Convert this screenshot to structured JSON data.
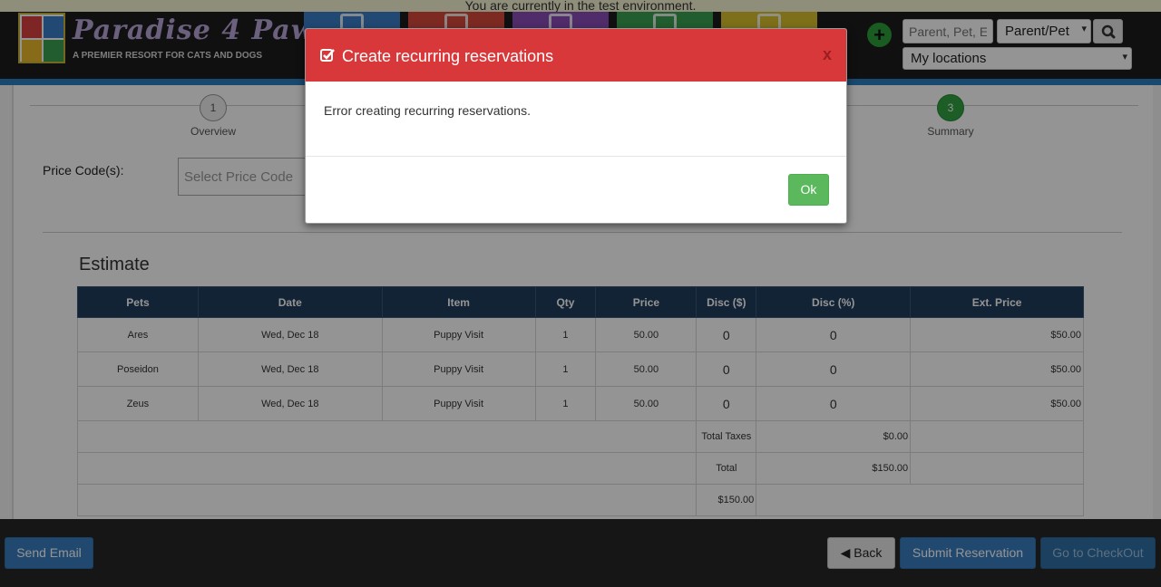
{
  "header": {
    "env_notice": "You are currently in the test environment.",
    "logo": {
      "name": "Paradise 4 Paws",
      "tagline": "A PREMIER RESORT FOR CATS AND DOGS"
    },
    "nav_tile_colors": [
      "#3a7fc8",
      "#d8493c",
      "#8a4db8",
      "#3aa050",
      "#d9c22e"
    ],
    "add_icon": "plus-circle-icon",
    "search": {
      "placeholder": "Parent, Pet, E",
      "value": ""
    },
    "search_type": {
      "selected": "Parent/Pet"
    },
    "search_icon": "search-icon",
    "location": {
      "selected": "My locations"
    }
  },
  "wizard": {
    "steps": [
      {
        "number": "1",
        "label": "Overview",
        "state": "inactive"
      },
      {
        "number": "3",
        "label": "Summary",
        "state": "active"
      }
    ]
  },
  "form": {
    "price_code_label": "Price Code(s):",
    "price_code_placeholder": "Select Price Code"
  },
  "estimate": {
    "title": "Estimate",
    "columns": [
      "Pets",
      "Date",
      "Item",
      "Qty",
      "Price",
      "Disc ($)",
      "Disc (%)",
      "Ext. Price"
    ],
    "rows": [
      {
        "pet": "Ares",
        "date": "Wed, Dec 18",
        "item": "Puppy Visit",
        "qty": "1",
        "price": "50.00",
        "disc_d": "0",
        "disc_p": "0",
        "ext": "$50.00"
      },
      {
        "pet": "Poseidon",
        "date": "Wed, Dec 18",
        "item": "Puppy Visit",
        "qty": "1",
        "price": "50.00",
        "disc_d": "0",
        "disc_p": "0",
        "ext": "$50.00"
      },
      {
        "pet": "Zeus",
        "date": "Wed, Dec 18",
        "item": "Puppy Visit",
        "qty": "1",
        "price": "50.00",
        "disc_d": "0",
        "disc_p": "0",
        "ext": "$50.00"
      }
    ],
    "total_taxes_label": "Total Taxes",
    "total_taxes_value": "$0.00",
    "total_label": "Total",
    "total_value": "$150.00",
    "grand_total": "$150.00"
  },
  "footer": {
    "send_email": "Send Email",
    "back": "Back",
    "back_icon": "arrow-left-circle-icon",
    "submit": "Submit Reservation",
    "checkout": "Go to CheckOut"
  },
  "modal": {
    "title": "Create recurring reservations",
    "title_icon": "checkbox-icon",
    "close": "x",
    "message": "Error creating recurring reservations.",
    "ok": "Ok",
    "header_color": "#d9383a"
  }
}
